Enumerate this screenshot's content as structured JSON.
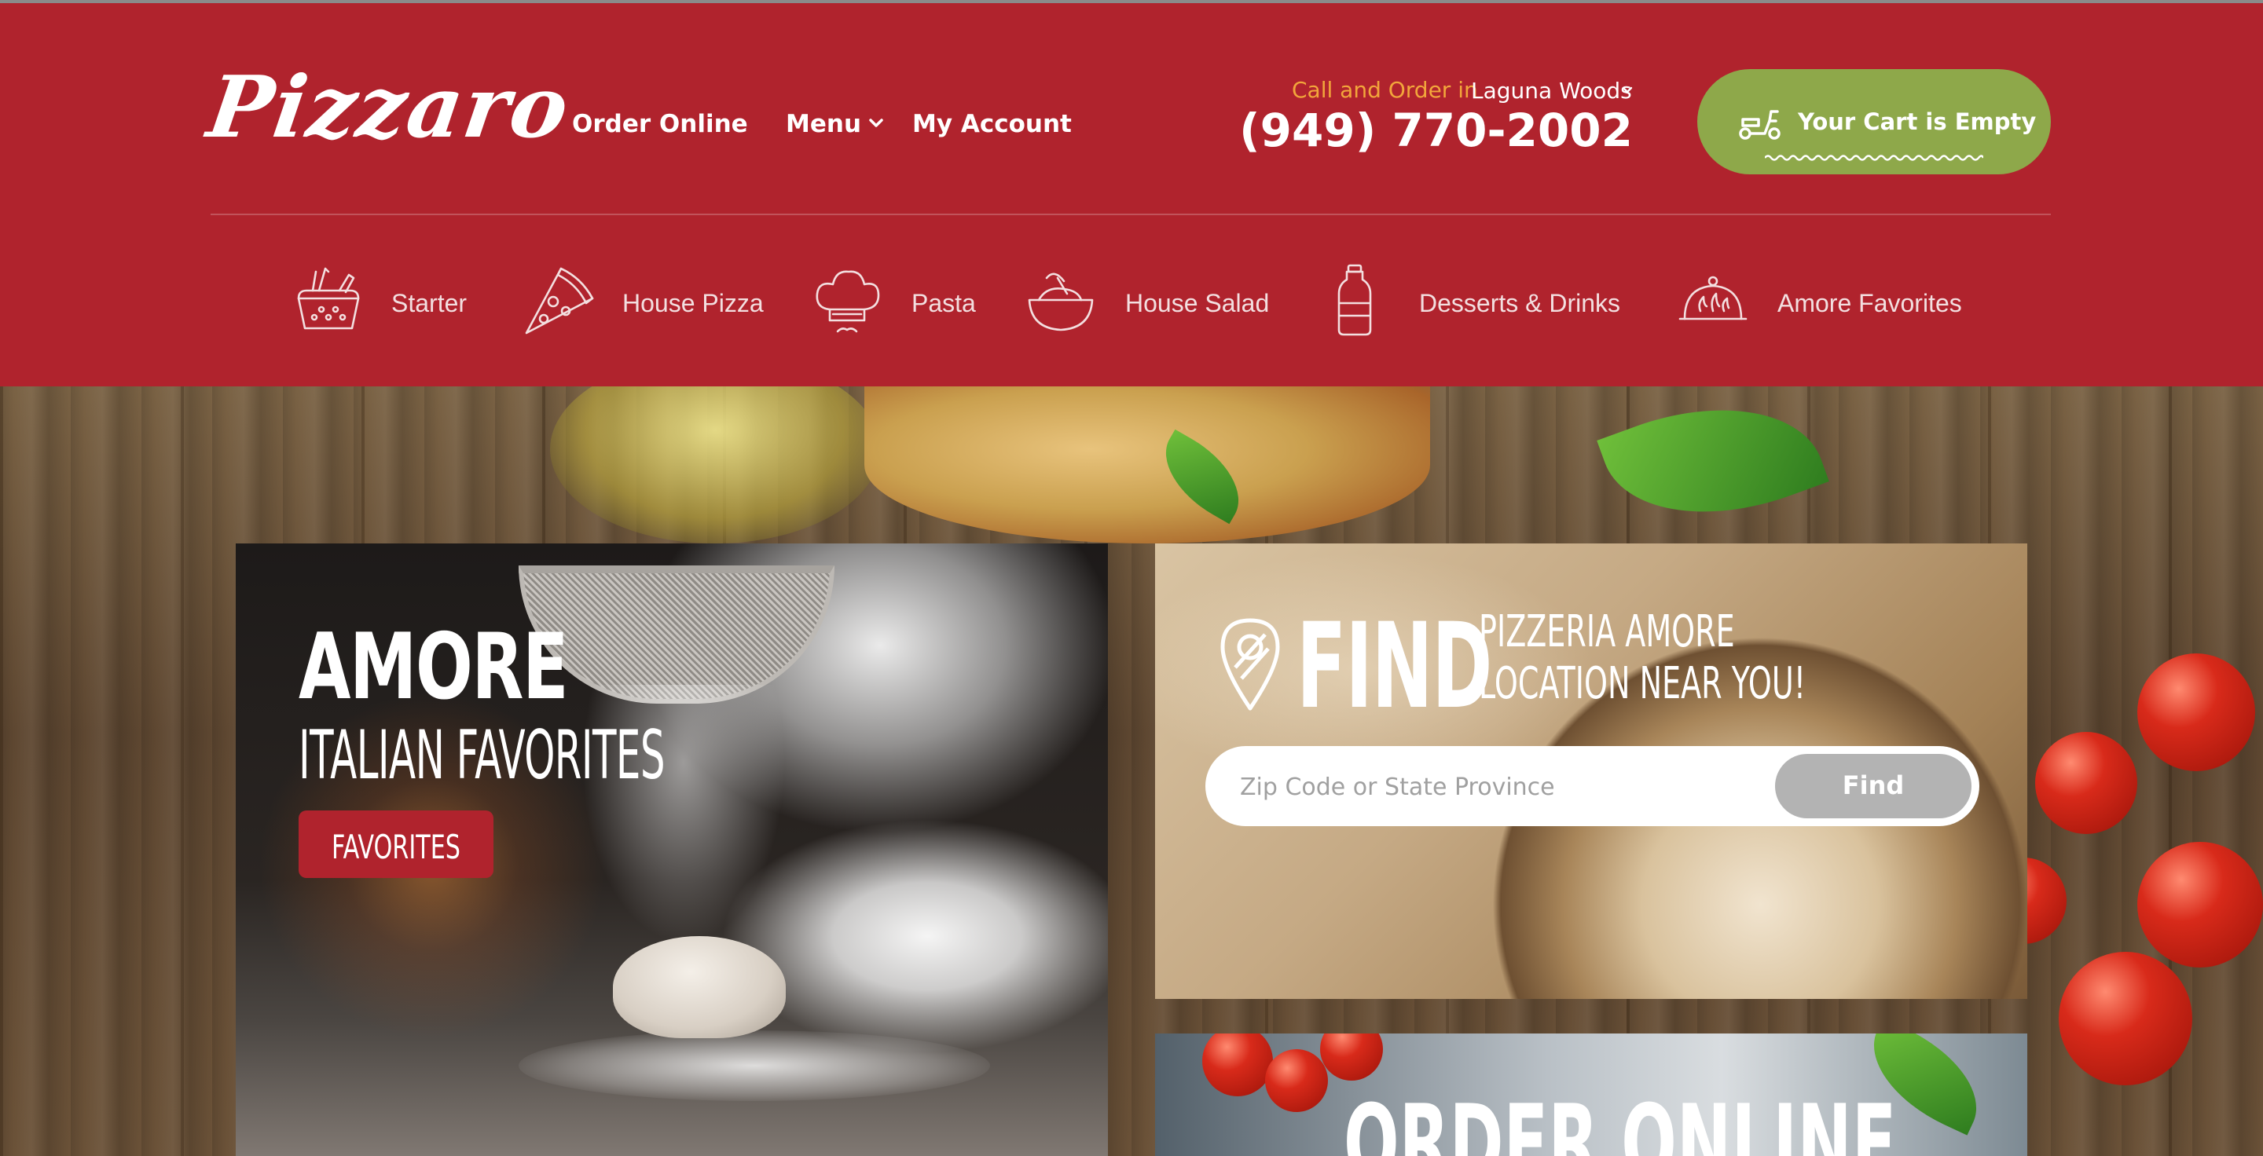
{
  "header": {
    "logo": "Pizzaro",
    "nav": [
      {
        "label": "Order Online"
      },
      {
        "label": "Menu"
      },
      {
        "label": "My Account"
      }
    ],
    "call_label": "Call and Order in",
    "location": "Laguna Woods",
    "phone": "(949) 770-2002",
    "cart_label": "Your Cart is Empty"
  },
  "categories": [
    {
      "label": "Starter",
      "icon": "basket-icon"
    },
    {
      "label": "House Pizza",
      "icon": "pizza-slice-icon"
    },
    {
      "label": "Pasta",
      "icon": "chef-hat-icon"
    },
    {
      "label": "House Salad",
      "icon": "salad-bowl-icon"
    },
    {
      "label": "Desserts & Drinks",
      "icon": "bottle-icon"
    },
    {
      "label": "Amore Favorites",
      "icon": "cloche-icon"
    }
  ],
  "hero": {
    "amore": {
      "title": "AMORE",
      "subtitle": "ITALIAN FAVORITES",
      "button": "FAVORITES"
    },
    "find": {
      "title": "FIND",
      "subtitle_line1": "PIZZERIA AMORE",
      "subtitle_line2": "LOCATION NEAR YOU!",
      "placeholder": "Zip Code or State Province",
      "button": "Find"
    },
    "order": {
      "title": "ORDER ONLINE"
    }
  },
  "colors": {
    "brand_red": "#b0232d",
    "cart_green": "#8ea84a",
    "call_orange": "#f2a63b",
    "find_button_gray": "#b3b3b3"
  }
}
